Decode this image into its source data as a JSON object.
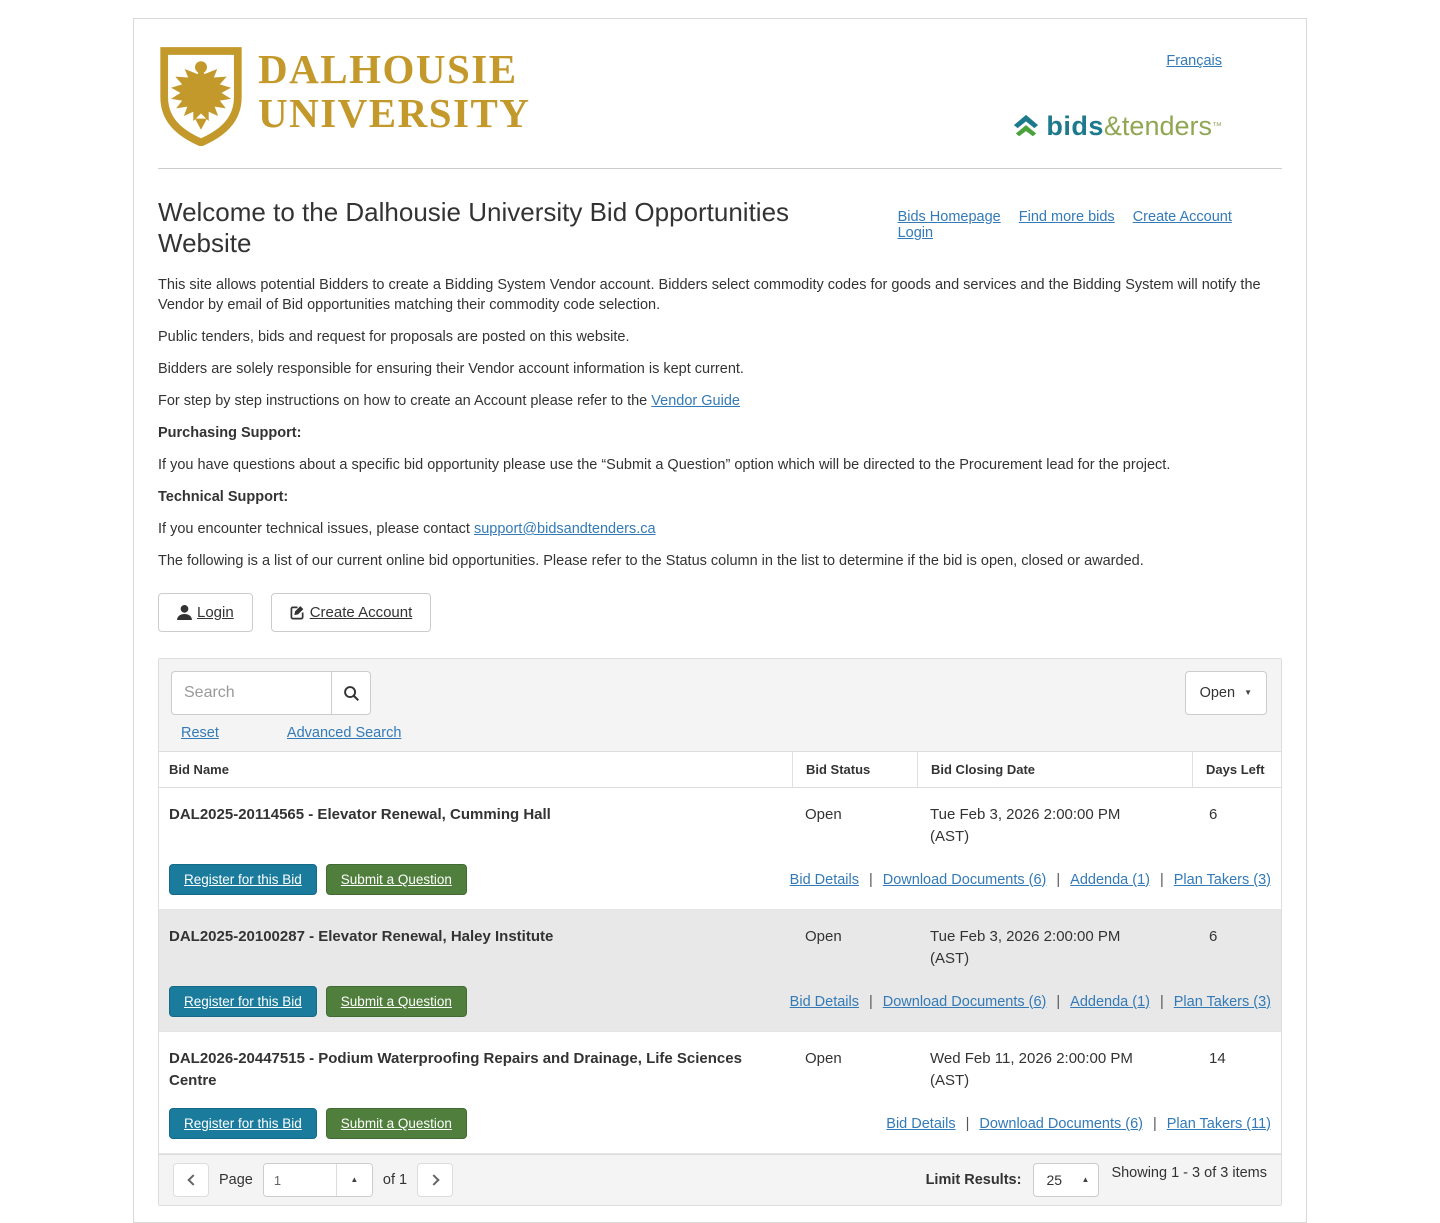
{
  "colors": {
    "dal_gold": "#C3992B",
    "link_blue": "#337ab7",
    "register_teal": "#1B7B9C",
    "question_green": "#4F7E3D",
    "brand_teal": "#1D7A8C",
    "brand_green": "#8FA653",
    "alt_row_grey": "#e8e8e8",
    "panel_band_grey": "#f4f4f4"
  },
  "header": {
    "university_line1": "DALHOUSIE",
    "university_line2": "UNIVERSITY",
    "language_link": "Français",
    "brand_bids": "bids",
    "brand_tenders": "&tenders",
    "brand_tm": "™"
  },
  "nav": {
    "links": [
      "Bids Homepage",
      "Find more bids",
      "Create Account",
      "Login"
    ]
  },
  "intro": {
    "title": "Welcome to the Dalhousie University Bid Opportunities Website",
    "p1": "This site allows potential Bidders to create a Bidding System Vendor account.  Bidders select commodity codes for goods and services and the Bidding System will notify the Vendor by email of Bid opportunities matching their commodity code selection.",
    "p2": "Public tenders, bids and request for proposals are posted on this website.",
    "p3": "Bidders are solely responsible for ensuring their Vendor account information is kept current.",
    "p4_prefix": "For step by step instructions on how to create an Account please refer to the ",
    "p4_link": "Vendor Guide",
    "purchasing_label": "Purchasing Support:",
    "purchasing_text": "If you have questions about a specific bid opportunity please use the “Submit a Question” option which will be directed to the Procurement lead for the project.",
    "technical_label": "Technical Support:",
    "technical_prefix": "If you encounter technical issues, please contact ",
    "technical_link": "support@bidsandtenders.ca",
    "list_intro": "The following is a list of our current online bid opportunities. Please refer to the Status column in the list to determine if the bid is open, closed or awarded."
  },
  "account_buttons": {
    "login": "Login",
    "create": "Create Account"
  },
  "search": {
    "placeholder": "Search",
    "reset": "Reset",
    "advanced": "Advanced Search",
    "status_filter": "Open"
  },
  "table": {
    "headers": [
      "Bid Name",
      "Bid Status",
      "Bid Closing Date",
      "Days Left"
    ],
    "register_label": "Register for this Bid",
    "question_label": "Submit a Question",
    "rows": [
      {
        "name": "DAL2025-20114565 - Elevator Renewal, Cumming Hall",
        "status": "Open",
        "closing": "Tue Feb 3, 2026 2:00:00 PM (AST)",
        "days_left": "6",
        "links": [
          "Bid Details",
          "Download Documents (6)",
          "Addenda (1)",
          "Plan Takers (3)"
        ]
      },
      {
        "name": "DAL2025-20100287 - Elevator Renewal, Haley Institute",
        "status": "Open",
        "closing": "Tue Feb 3, 2026 2:00:00 PM (AST)",
        "days_left": "6",
        "links": [
          "Bid Details",
          "Download Documents (6)",
          "Addenda (1)",
          "Plan Takers (3)"
        ]
      },
      {
        "name": "DAL2026-20447515 - Podium Waterproofing Repairs and Drainage, Life Sciences Centre",
        "status": "Open",
        "closing": "Wed Feb 11, 2026 2:00:00 PM (AST)",
        "days_left": "14",
        "links": [
          "Bid Details",
          "Download Documents (6)",
          "Plan Takers (11)"
        ]
      }
    ]
  },
  "pagination": {
    "page_label": "Page",
    "page_value": "1",
    "of_label": "of 1",
    "limit_label": "Limit Results:",
    "limit_value": "25",
    "showing": "Showing 1 - 3 of 3 items"
  },
  "icons": {
    "caret_up": "▲",
    "caret_down": "▼"
  }
}
